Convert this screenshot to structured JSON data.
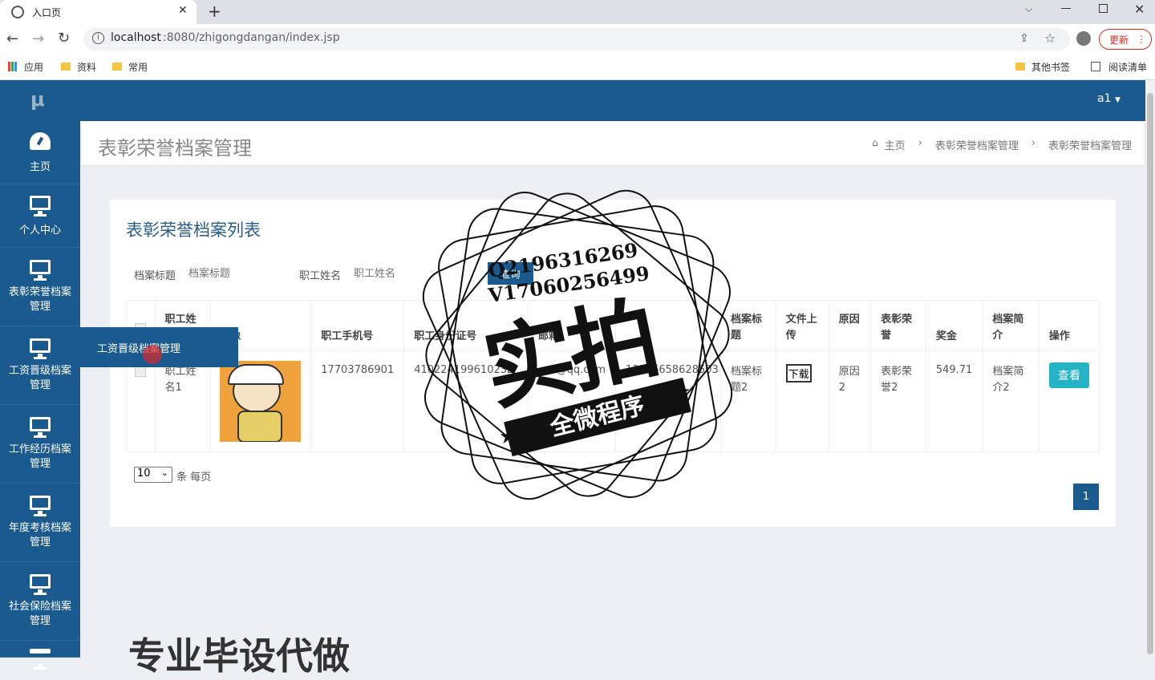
{
  "browser": {
    "tab_title": "入口页",
    "url_host": "localhost",
    "url_rest": ":8080/zhigongdangan/index.jsp",
    "update_label": "更新",
    "bookmarks": [
      "应用",
      "资料",
      "常用"
    ],
    "bookmarks_right": [
      "其他书签",
      "阅读清单"
    ]
  },
  "app": {
    "logo": "μ",
    "user": "a1",
    "sidebar": [
      {
        "label": "主页",
        "icon": "dashboard-icon"
      },
      {
        "label": "个人中心",
        "icon": "monitor-icon"
      },
      {
        "label": "表彰荣誉档案管理",
        "icon": "monitor-icon"
      },
      {
        "label": "工资晋级档案管理",
        "icon": "monitor-icon"
      },
      {
        "label": "工作经历档案管理",
        "icon": "monitor-icon"
      },
      {
        "label": "年度考核档案管理",
        "icon": "monitor-icon"
      },
      {
        "label": "社会保险档案管理",
        "icon": "monitor-icon"
      }
    ],
    "hover_popup": "工资晋级档案管理"
  },
  "page": {
    "title": "表彰荣誉档案管理",
    "breadcrumb": [
      "主页",
      "表彰荣誉档案管理",
      "表彰荣誉档案管理"
    ],
    "panel_title": "表彰荣誉档案列表",
    "filters": [
      {
        "label": "档案标题",
        "placeholder": "档案标题"
      },
      {
        "label": "职工姓名",
        "placeholder": "职工姓名"
      }
    ],
    "search_button": "查询",
    "columns": [
      "",
      "职工姓名",
      "头像",
      "职工手机号",
      "职工身份证号",
      "邮箱",
      "",
      "档案标题",
      "文件上传",
      "原因",
      "表彰荣誉",
      "奖金",
      "档案简介",
      "操作"
    ],
    "rows": [
      {
        "name": "职工姓名1",
        "phone": "17703786901",
        "id_card": "410224199610232",
        "email": "@qq.com",
        "other": "13866658628503",
        "title": "档案标题2",
        "upload": "下载",
        "reason": "原因2",
        "honor": "表彰荣誉2",
        "bonus": "549.71",
        "intro": "档案简介2",
        "action": "查看"
      }
    ],
    "page_size": "10",
    "page_size_suffix": "条 每页",
    "current_page": "1"
  },
  "watermark": {
    "qq": "Q2196316269",
    "v": "V17060256499",
    "big": "实拍",
    "banner": "全微程序",
    "bottom": "专业毕设代做"
  },
  "colors": {
    "brand": "#1a5a8e",
    "view_button": "#23b3c4"
  }
}
